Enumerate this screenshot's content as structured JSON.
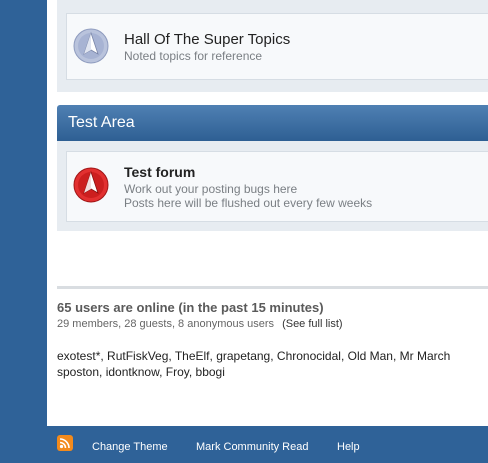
{
  "forums_top": {
    "title": "Hall Of The Super Topics",
    "description": "Noted topics for reference",
    "icon": "forum-read-icon"
  },
  "category": {
    "title": "Test Area"
  },
  "test_forum": {
    "title": "Test forum",
    "desc_line1": "Work out your posting bugs here",
    "desc_line2": "Posts here will be flushed out every few weeks",
    "icon": "forum-unread-icon"
  },
  "online": {
    "title": "65 users are online (in the past 15 minutes)",
    "summary": "29 members, 28 guests, 8 anonymous users",
    "full_list_link": "(See full list)",
    "users_line1": "exotest*, RutFiskVeg, TheElf, grapetang, Chronocidal, Old Man, Mr March",
    "users_line2": "sposton, idontknow, Froy, bbogi"
  },
  "footer": {
    "change_theme": "Change Theme",
    "mark_read": "Mark Community Read",
    "help": "Help"
  },
  "colors": {
    "background": "#2f6298",
    "category_header": "#3d6fa3",
    "unread_icon": "#d42020",
    "read_icon": "#9aa7c9"
  }
}
